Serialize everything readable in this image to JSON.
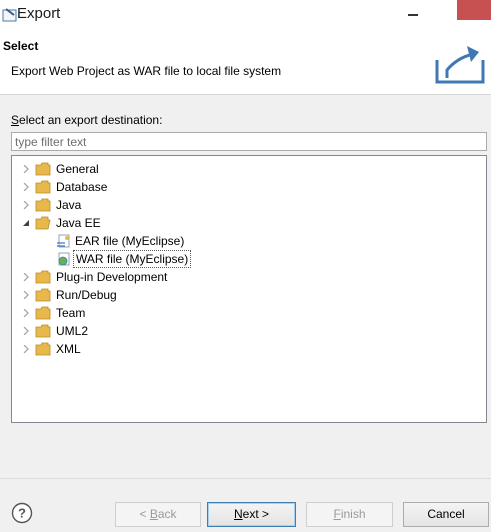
{
  "window": {
    "title": "Export"
  },
  "header": {
    "title": "Select",
    "description": "Export Web Project as WAR file to local file system"
  },
  "destination": {
    "label_prefix": "S",
    "label_rest": "elect an export destination:",
    "filter_placeholder": "type filter text"
  },
  "tree": {
    "items": [
      {
        "label": "General",
        "expanded": false
      },
      {
        "label": "Database",
        "expanded": false
      },
      {
        "label": "Java",
        "expanded": false
      },
      {
        "label": "Java EE",
        "expanded": true
      },
      {
        "label": "EAR file (MyEclipse)",
        "child": true
      },
      {
        "label": "WAR file (MyEclipse)",
        "child": true,
        "selected": true
      },
      {
        "label": "Plug-in Development",
        "expanded": false
      },
      {
        "label": "Run/Debug",
        "expanded": false
      },
      {
        "label": "Team",
        "expanded": false
      },
      {
        "label": "UML2",
        "expanded": false
      },
      {
        "label": "XML",
        "expanded": false
      }
    ]
  },
  "buttons": {
    "back_prefix": "< ",
    "back_key": "B",
    "back_rest": "ack",
    "next_key": "N",
    "next_rest": "ext >",
    "finish_key": "F",
    "finish_rest": "inish",
    "cancel": "Cancel"
  },
  "icons": {
    "folder": "folder-icon",
    "ear": "ear-file-icon",
    "war": "war-file-icon",
    "help": "help-icon"
  },
  "colors": {
    "folder": "#e8b84a",
    "close": "#c75050",
    "accent": "#3c7fb1"
  }
}
